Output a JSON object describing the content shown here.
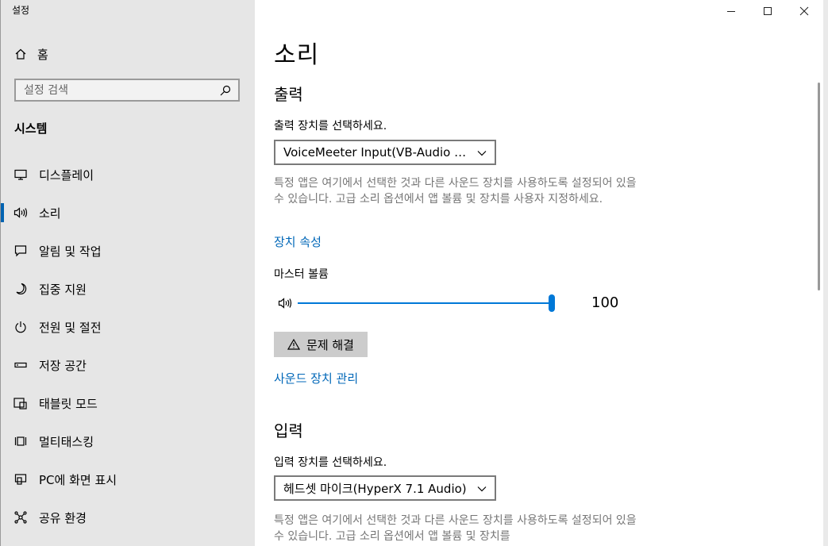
{
  "window": {
    "title": "설정"
  },
  "sidebar": {
    "home_label": "홈",
    "search_placeholder": "설정 검색",
    "section_title": "시스템",
    "items": [
      {
        "label": "디스플레이",
        "icon": "display-icon"
      },
      {
        "label": "소리",
        "icon": "speaker-icon",
        "selected": true
      },
      {
        "label": "알림 및 작업",
        "icon": "notification-icon"
      },
      {
        "label": "집중 지원",
        "icon": "moon-icon"
      },
      {
        "label": "전원 및 절전",
        "icon": "power-icon"
      },
      {
        "label": "저장 공간",
        "icon": "storage-icon"
      },
      {
        "label": "태블릿 모드",
        "icon": "tablet-icon"
      },
      {
        "label": "멀티태스킹",
        "icon": "multitasking-icon"
      },
      {
        "label": "PC에 화면 표시",
        "icon": "project-icon"
      },
      {
        "label": "공유 환경",
        "icon": "share-icon"
      }
    ]
  },
  "main": {
    "title": "소리",
    "output": {
      "heading": "출력",
      "device_label": "출력 장치를 선택하세요.",
      "device_value": "VoiceMeeter Input(VB-Audio Voi...",
      "description": "특정 앱은 여기에서 선택한 것과 다른 사운드 장치를 사용하도록 설정되어 있을 수 있습니다. 고급 소리 옵션에서 앱 볼륨 및 장치를 사용자 지정하세요.",
      "properties_link": "장치 속성",
      "volume_label": "마스터 볼륨",
      "volume_value": "100",
      "troubleshoot_label": "문제 해결",
      "manage_link": "사운드 장치 관리"
    },
    "input": {
      "heading": "입력",
      "device_label": "입력 장치를 선택하세요.",
      "device_value": "헤드셋 마이크(HyperX 7.1 Audio)",
      "description": "특정 앱은 여기에서 선택한 것과 다른 사운드 장치를 사용하도록 설정되어 있을 수 있습니다. 고급 소리 옵션에서 앱 볼륨 및 장치를"
    }
  },
  "colors": {
    "accent": "#0078d7",
    "link": "#0067b8",
    "sidebar_bg": "#e6e6e6"
  }
}
